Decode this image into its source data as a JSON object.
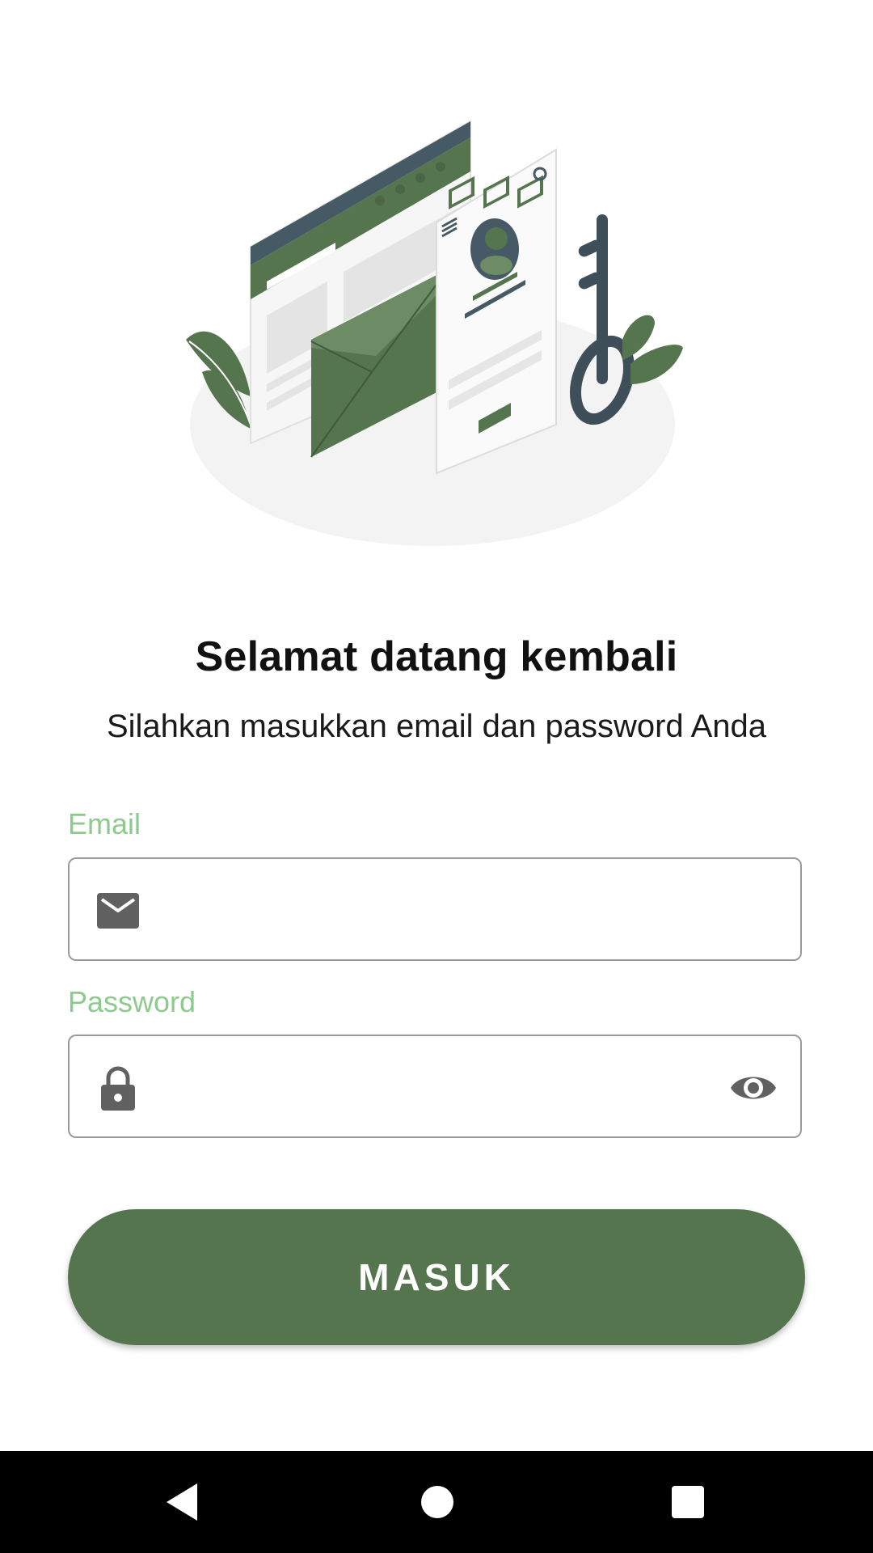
{
  "header": {
    "title": "Selamat datang kembali",
    "subtitle": "Silahkan masukkan email dan password Anda"
  },
  "form": {
    "email": {
      "label": "Email",
      "value": "",
      "placeholder": "",
      "icon": "email-icon"
    },
    "password": {
      "label": "Password",
      "value": "",
      "placeholder": "",
      "icon": "lock-icon",
      "toggle_icon": "eye-icon"
    },
    "submit_label": "MASUK"
  },
  "navbar": {
    "back_icon": "back-icon",
    "home_icon": "home-icon",
    "recents_icon": "recents-icon"
  },
  "colors": {
    "primary": "#55754e",
    "label": "#8ec98e",
    "field_border": "#9a9a9a",
    "icon": "#616161",
    "illustration_dark": "#455a64"
  }
}
